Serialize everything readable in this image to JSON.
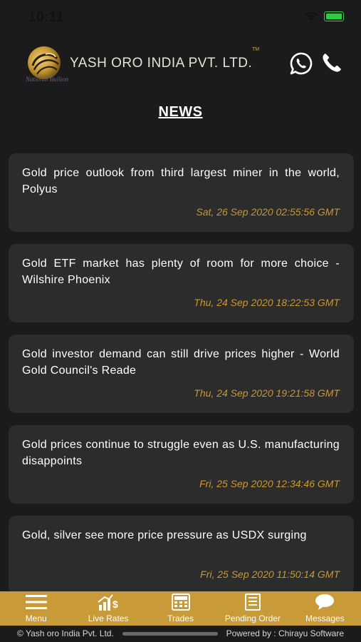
{
  "status_bar": {
    "time": "10:11"
  },
  "header": {
    "brand_name": "YASH ORO INDIA PVT. LTD.",
    "trademark": "TM",
    "tagline": "National Bullion"
  },
  "page": {
    "title": "NEWS"
  },
  "news": [
    {
      "headline": "Gold price outlook from third largest miner in the world, Polyus",
      "date": "Sat, 26 Sep 2020 02:55:56 GMT"
    },
    {
      "headline": "Gold ETF market has plenty of room for more choice - Wilshire Phoenix",
      "date": "Thu, 24 Sep 2020 18:22:53 GMT"
    },
    {
      "headline": "Gold investor demand can still drive prices higher - World Gold Council's Reade",
      "date": "Thu, 24 Sep 2020 19:21:58 GMT"
    },
    {
      "headline": "Gold prices continue to struggle even as U.S. manufacturing disappoints",
      "date": "Fri, 25 Sep 2020 12:34:46 GMT"
    },
    {
      "headline": "Gold, silver see more price pressure as USDX surging",
      "date": "Fri, 25 Sep 2020 11:50:14 GMT"
    }
  ],
  "bottom_nav": [
    {
      "label": "Menu",
      "icon": "menu-icon"
    },
    {
      "label": "Live Rates",
      "icon": "live-rates-icon"
    },
    {
      "label": "Trades",
      "icon": "trades-icon"
    },
    {
      "label": "Pending Order",
      "icon": "pending-order-icon"
    },
    {
      "label": "Messages",
      "icon": "messages-icon"
    }
  ],
  "footer": {
    "left": "© Yash oro India Pvt. Ltd.",
    "right": "Powered by : Chirayu Software"
  },
  "colors": {
    "background": "#1b1b1b",
    "card": "#2c2c2c",
    "accent_gold": "#c99a38",
    "date_text": "#c9982e"
  }
}
